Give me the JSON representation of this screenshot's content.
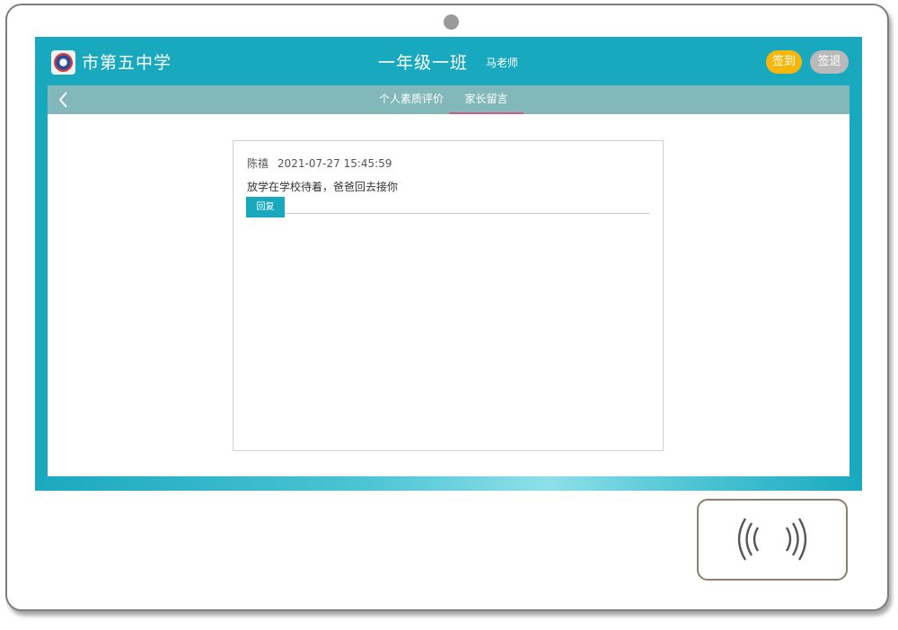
{
  "header": {
    "school_name": "市第五中学",
    "class_name": "一年级一班",
    "teacher": "马老师",
    "signin_label": "签到",
    "signout_label": "签退"
  },
  "tabs": [
    {
      "label": "个人素质评价",
      "active": false
    },
    {
      "label": "家长留言",
      "active": true
    }
  ],
  "messages": [
    {
      "author": "陈禧",
      "timestamp": "2021-07-27 15:45:59",
      "text": "放学在学校待着，爸爸回去接你",
      "reply_label": "回复"
    }
  ],
  "icons": {
    "back": "chevron-left-icon",
    "logo": "school-logo-icon",
    "nfc": "nfc-signal-icon"
  },
  "colors": {
    "primary": "#19a9bf",
    "nav_bar": "#82b8b9",
    "signin": "#f6b70a",
    "signout": "#b9b9b9",
    "active_tab_underline": "#d05a8a"
  }
}
